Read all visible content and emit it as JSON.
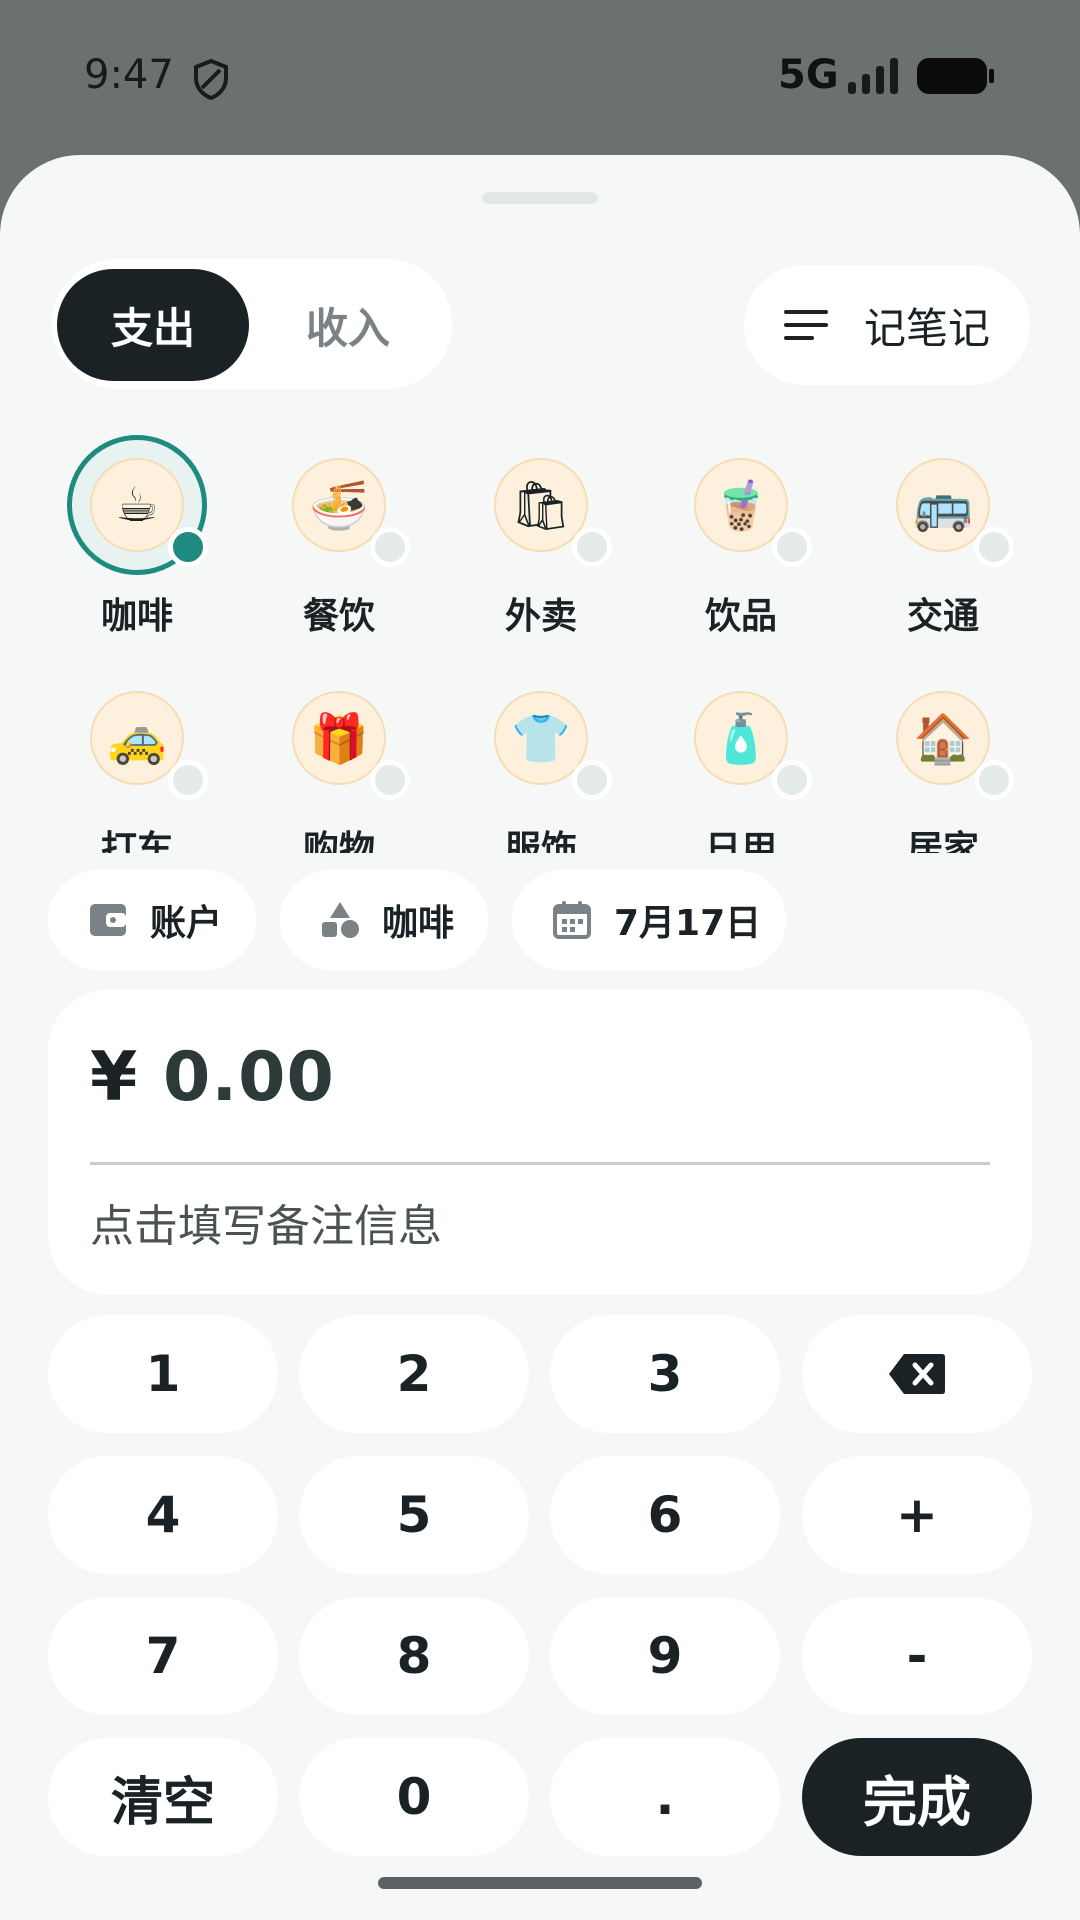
{
  "status_bar": {
    "time": "9:47",
    "network": "5G"
  },
  "header": {
    "tabs": [
      {
        "label": "支出",
        "selected": true
      },
      {
        "label": "收入",
        "selected": false
      }
    ],
    "note_button_label": "记笔记"
  },
  "categories": [
    {
      "label": "咖啡",
      "icon": "☕",
      "selected": true
    },
    {
      "label": "餐饮",
      "icon": "🍜",
      "selected": false
    },
    {
      "label": "外卖",
      "icon": "🛍",
      "selected": false
    },
    {
      "label": "饮品",
      "icon": "🧋",
      "selected": false
    },
    {
      "label": "交通",
      "icon": "🚌",
      "selected": false
    },
    {
      "label": "打车",
      "icon": "🚕",
      "selected": false
    },
    {
      "label": "购物",
      "icon": "🎁",
      "selected": false
    },
    {
      "label": "服饰",
      "icon": "👕",
      "selected": false
    },
    {
      "label": "日用",
      "icon": "🧴",
      "selected": false
    },
    {
      "label": "居家",
      "icon": "🏠",
      "selected": false
    }
  ],
  "chips": {
    "account": "账户",
    "category": "咖啡",
    "date": "7月17日"
  },
  "amount": {
    "currency": "¥",
    "value": "0.00",
    "remark_placeholder": "点击填写备注信息"
  },
  "keypad": {
    "k1": "1",
    "k2": "2",
    "k3": "3",
    "k4": "4",
    "k5": "5",
    "k6": "6",
    "plus": "+",
    "k7": "7",
    "k8": "8",
    "k9": "9",
    "minus": "-",
    "clear": "清空",
    "k0": "0",
    "dot": ".",
    "done": "完成"
  },
  "colors": {
    "accent": "#1f8a80",
    "dark": "#1b2226",
    "sheet_bg": "#f6f8f8",
    "overlay": "#6b7070"
  }
}
